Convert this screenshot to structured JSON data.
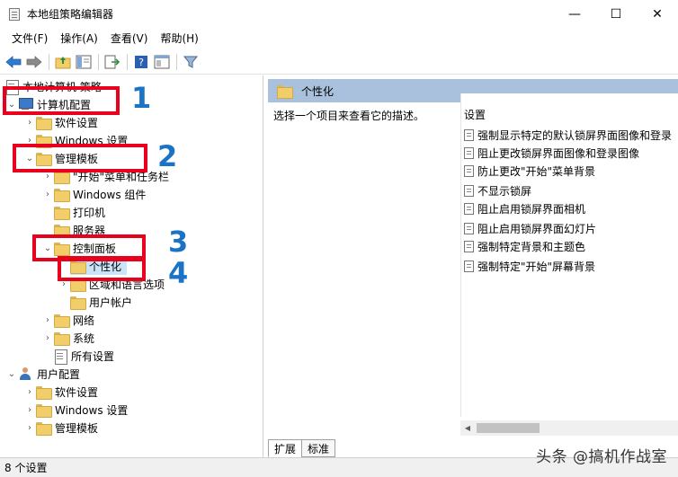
{
  "window": {
    "title": "本地组策略编辑器",
    "minimize": "—",
    "maximize": "☐",
    "close": "✕"
  },
  "menu": [
    "文件(F)",
    "操作(A)",
    "查看(V)",
    "帮助(H)"
  ],
  "tree": {
    "root": "本地计算机 策略",
    "computer": "计算机配置",
    "software": "软件设置",
    "windows": "Windows 设置",
    "admin": "管理模板",
    "start": "\"开始\"菜单和任务栏",
    "wincomp": "Windows 组件",
    "printer": "打印机",
    "server": "服务器",
    "control": "控制面板",
    "personal": "个性化",
    "region": "区域和语言选项",
    "account": "用户帐户",
    "network": "网络",
    "system": "系统",
    "all": "所有设置",
    "user": "用户配置",
    "u_software": "软件设置",
    "u_windows": "Windows 设置",
    "u_admin": "管理模板"
  },
  "right": {
    "header": "个性化",
    "description": "选择一个项目来查看它的描述。",
    "column": "设置",
    "settings": [
      "强制显示特定的默认锁屏界面图像和登录",
      "阻止更改锁屏界面图像和登录图像",
      "防止更改\"开始\"菜单背景",
      "不显示锁屏",
      "阻止启用锁屏界面相机",
      "阻止启用锁屏界面幻灯片",
      "强制特定背景和主题色",
      "强制特定\"开始\"屏幕背景"
    ]
  },
  "tabs": [
    "扩展",
    "标准"
  ],
  "status": "8 个设置",
  "watermark": "头条 @搞机作战室",
  "annotations": [
    "1",
    "2",
    "3",
    "4"
  ],
  "colors": {
    "annotation_box": "#e8001c",
    "annotation_num": "#1b73c6",
    "header_bg": "#a9c1dc",
    "selection": "#cce4f7"
  }
}
